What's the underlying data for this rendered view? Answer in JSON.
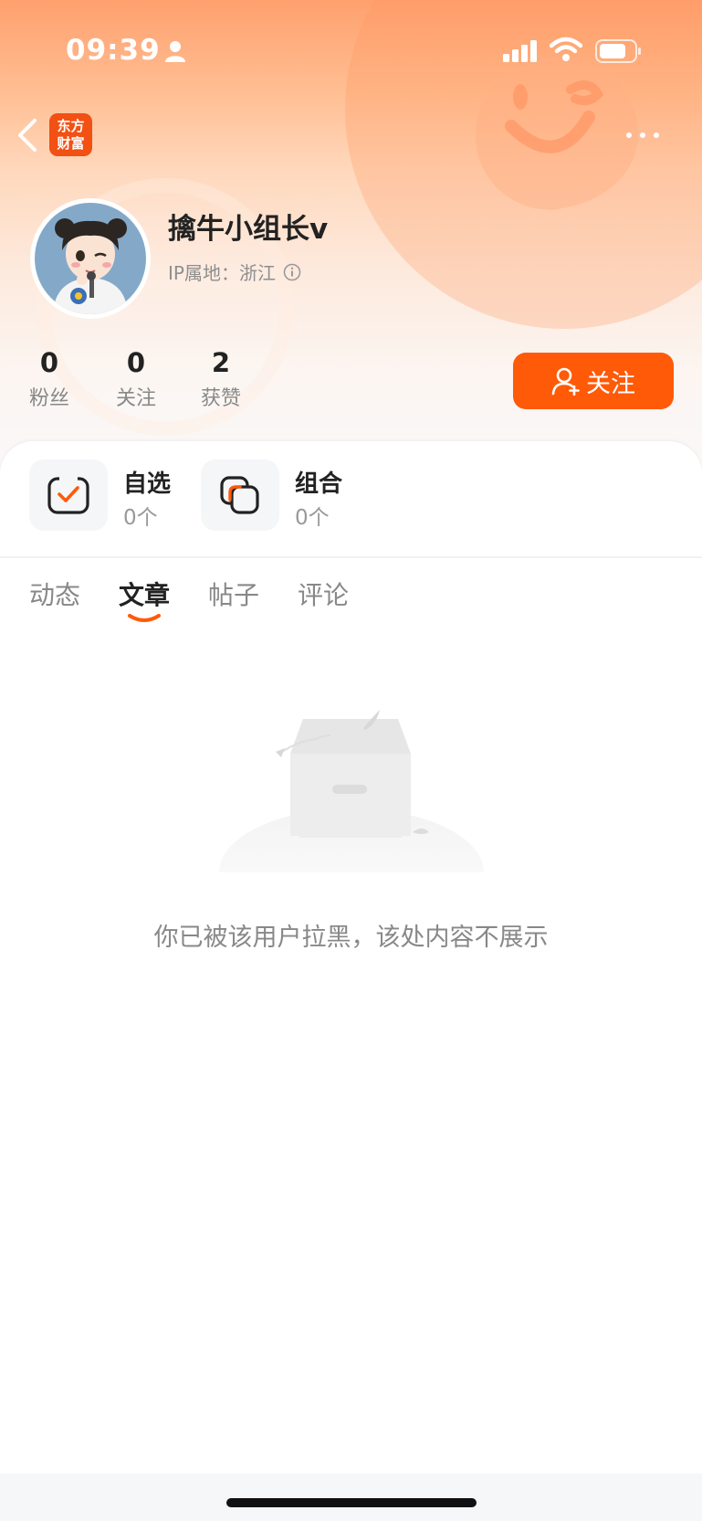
{
  "status_bar": {
    "time": "09:39"
  },
  "nav": {
    "app_logo_line1": "东方",
    "app_logo_line2": "财富"
  },
  "profile": {
    "username": "擒牛小组长v",
    "ip_location": "IP属地：浙江"
  },
  "stats": [
    {
      "value": "0",
      "label": "粉丝"
    },
    {
      "value": "0",
      "label": "关注"
    },
    {
      "value": "2",
      "label": "获赞"
    }
  ],
  "follow_button": {
    "label": "关注"
  },
  "features": [
    {
      "title": "自选",
      "count": "0个"
    },
    {
      "title": "组合",
      "count": "0个"
    }
  ],
  "tabs": [
    {
      "label": "动态"
    },
    {
      "label": "文章"
    },
    {
      "label": "帖子"
    },
    {
      "label": "评论"
    }
  ],
  "active_tab": "文章",
  "empty_state": {
    "message": "你已被该用户拉黑，该处内容不展示"
  },
  "colors": {
    "accent": "#ff5a08",
    "logo": "#f35014"
  }
}
